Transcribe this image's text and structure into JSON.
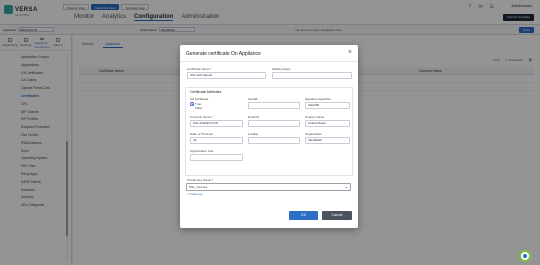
{
  "brand": {
    "logo_text": "VERSA",
    "logo_sub": "NETWORKS"
  },
  "view_switch": [
    "Director View",
    "Appliance View",
    "Template View"
  ],
  "main_nav": [
    "Monitor",
    "Analytics",
    "Configuration",
    "Administration"
  ],
  "user": {
    "name": "Administrator"
  },
  "commit_label": "Commit Template",
  "context": {
    "appliance_label": "Appliance",
    "appliance_value": "BRANCH-01",
    "org_label": "Organization",
    "org_value": "SE-DEMO",
    "info_text": "You are currently in Appliance View",
    "deploy_label": "Build"
  },
  "sidebar": {
    "tabs": [
      "Networking",
      "Services",
      "Objects & Connectors",
      "Others"
    ],
    "items": [
      "Application Groups",
      "Applications",
      "CA Certificates",
      "CA Chains",
      "Captive Portal Cust...",
      "Certificates",
      "CRL",
      "DIP Objects",
      "EIP Profiles",
      "Endpoint Protection",
      "Geo Circles",
      "IPAM Address",
      "Kerol",
      "Operating System",
      "PAC Files",
      "Proxy Apps",
      "SASE Clients",
      "Scanners",
      "Services",
      "URL Categories"
    ]
  },
  "main": {
    "tabs": [
      "Director",
      "Appliance"
    ],
    "actions": {
      "add": "Add",
      "upload": "Upload File"
    },
    "columns": [
      "Certificate Name",
      "Common Name"
    ]
  },
  "modal": {
    "title": "Generate certificate On Appliance",
    "certificate_name_label": "Certificate Name *",
    "certificate_name_value": "SSL-Self-Signed",
    "validity_label": "Validity (days)",
    "attributes_title": "Certificate Attributes",
    "ca_label": "CA Certificate",
    "ca_true": "True",
    "ca_false": "False",
    "serial_label": "Serial#",
    "sig_label": "Signature Algorithm",
    "sig_value": "SHA256",
    "common_label": "Common Name *",
    "common_value": "SSL-INSPECTION",
    "email_label": "Email ID",
    "country_label": "Country Name",
    "country_value": "United States",
    "state_label": "State or Province",
    "state_value": "VA",
    "locality_label": "Locality",
    "org_label": "Organization",
    "org_value": "SE-DEMO",
    "unit_label": "Organization Unit",
    "pk_label": "Private Key Name *",
    "pk_value": "SSL_Cert.key",
    "pk_link": "+ Private Key",
    "ok_label": "OK",
    "cancel_label": "Cancel"
  },
  "colors": {
    "accent": "#2c6fc4",
    "dark": "#1e2a3b",
    "teal": "#39a7a0"
  }
}
